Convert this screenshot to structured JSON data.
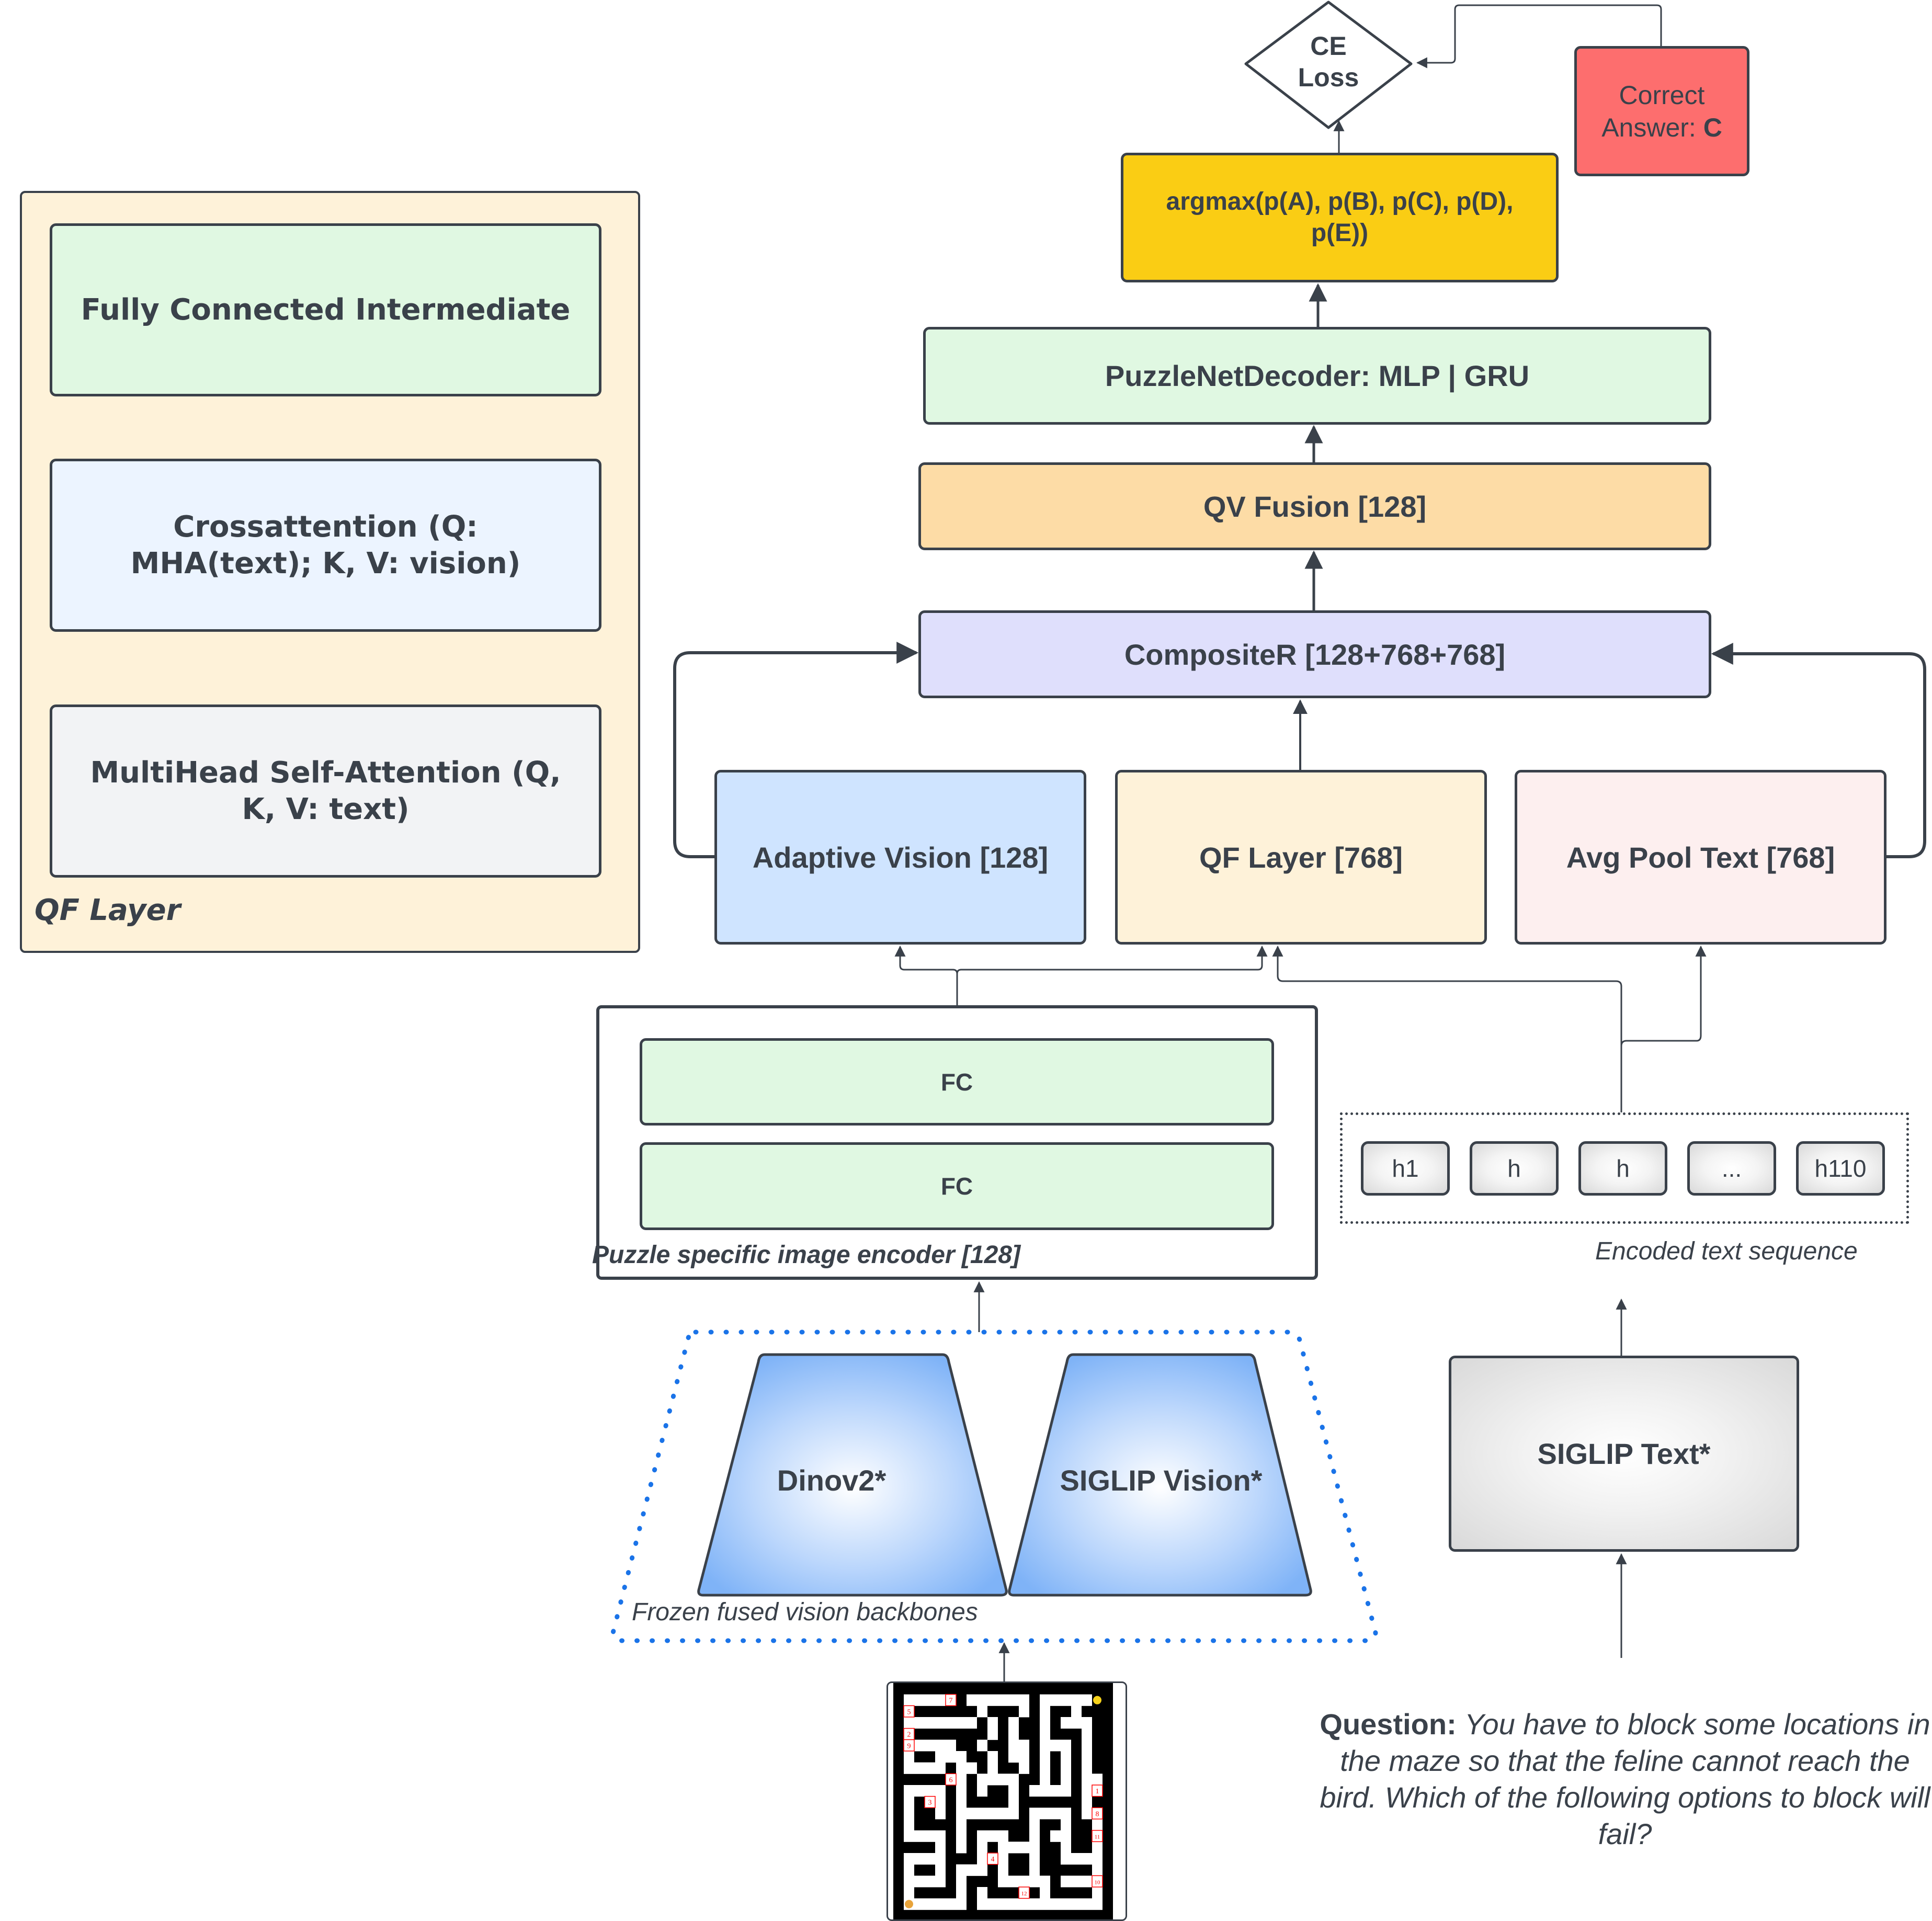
{
  "qf_panel": {
    "caption": "QF Layer",
    "blocks": {
      "fully_connected": "Fully Connected Intermediate",
      "crossattention": "Crossattention (Q: MHA(text); K, V: vision)",
      "multihead": "MultiHead Self-Attention (Q, K, V: text)"
    }
  },
  "output": {
    "loss_line1": "CE",
    "loss_line2": "Loss",
    "correct_answer_prefix": "Correct Answer: ",
    "correct_answer_value": "C",
    "argmax": "argmax(p(A), p(B), p(C), p(D), p(E))"
  },
  "pipeline": {
    "decoder": "PuzzleNetDecoder: MLP | GRU",
    "qv_fusion": "QV Fusion [128]",
    "composite": "CompositeR [128+768+768]",
    "adaptive_vision": "Adaptive Vision [128]",
    "qf_layer": "QF Layer [768]",
    "avg_pool_text": "Avg Pool Text [768]"
  },
  "image_encoder": {
    "fc_top": "FC",
    "fc_bottom": "FC",
    "caption": "Puzzle specific image encoder [128]"
  },
  "text_sequence": {
    "tokens": [
      "h1",
      "h",
      "h",
      "...",
      "h110"
    ],
    "caption": "Encoded text sequence"
  },
  "backbones": {
    "dinov2": "Dinov2*",
    "siglip_vision": "SIGLIP Vision*",
    "caption": "Frozen fused vision backbones"
  },
  "text_encoder": {
    "siglip_text": "SIGLIP Text*"
  },
  "question": {
    "label": "Question:",
    "text": "You have to block some locations in the maze so that the feline cannot reach the bird. Which of the following options to block will fail?"
  },
  "maze": {
    "markers": [
      "7",
      "5",
      "2",
      "9",
      "6",
      "3",
      "1",
      "8",
      "11",
      "4",
      "10",
      "12"
    ],
    "start_icon": "cat-emoji",
    "goal_icon": "chick-emoji"
  },
  "colors": {
    "stroke": "#3a414a",
    "qf_panel_bg": "#fef2d9",
    "fully_connected_bg": "#e0f8e2",
    "crossattention_bg": "#ecf4ff",
    "multihead_bg": "#f2f3f5",
    "argmax_bg": "#facd14",
    "correct_answer_bg": "#fd6e6e",
    "decoder_bg": "#e0f8e2",
    "qv_fusion_bg": "#fddca6",
    "composite_bg": "#dfdffc",
    "adaptive_vision_bg": "#cfe4ff",
    "qf_layer_bg": "#fef2d9",
    "avg_pool_bg": "#fdefef",
    "fc_bg": "#e0f8e2",
    "frozen_border": "#1a73e8",
    "marker_red": "#ff0000"
  }
}
